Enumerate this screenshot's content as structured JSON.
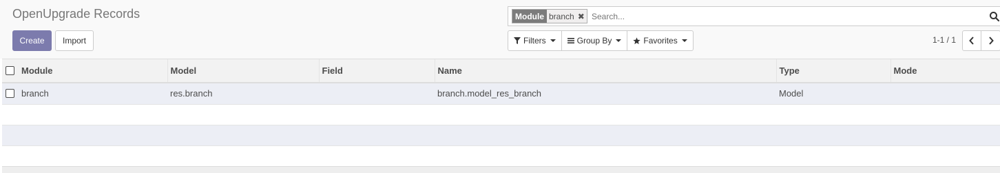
{
  "breadcrumb": {
    "title": "OpenUpgrade Records"
  },
  "buttons": {
    "create": "Create",
    "import": "Import"
  },
  "search": {
    "facet_label": "Module",
    "facet_value": "branch",
    "remove_glyph": "✖",
    "placeholder": "Search...",
    "icon": "search-icon"
  },
  "filters": {
    "filters_label": "Filters",
    "filters_icon": "filter-icon",
    "group_by_label": "Group By",
    "group_by_icon": "bars-icon",
    "favorites_label": "Favorites",
    "favorites_icon": "star-icon"
  },
  "pager": {
    "value": "1-1 / 1",
    "prev_icon": "chevron-left-icon",
    "next_icon": "chevron-right-icon"
  },
  "table": {
    "columns": [
      "Module",
      "Model",
      "Field",
      "Name",
      "Type",
      "Mode"
    ],
    "rows": [
      {
        "module": "branch",
        "model": "res.branch",
        "field": "",
        "name": "branch.model_res_branch",
        "type": "Model",
        "mode": ""
      }
    ]
  },
  "colors": {
    "primary": "#7c7bad",
    "row_highlight": "#eceef5",
    "header_bg": "#f2f2f2"
  }
}
